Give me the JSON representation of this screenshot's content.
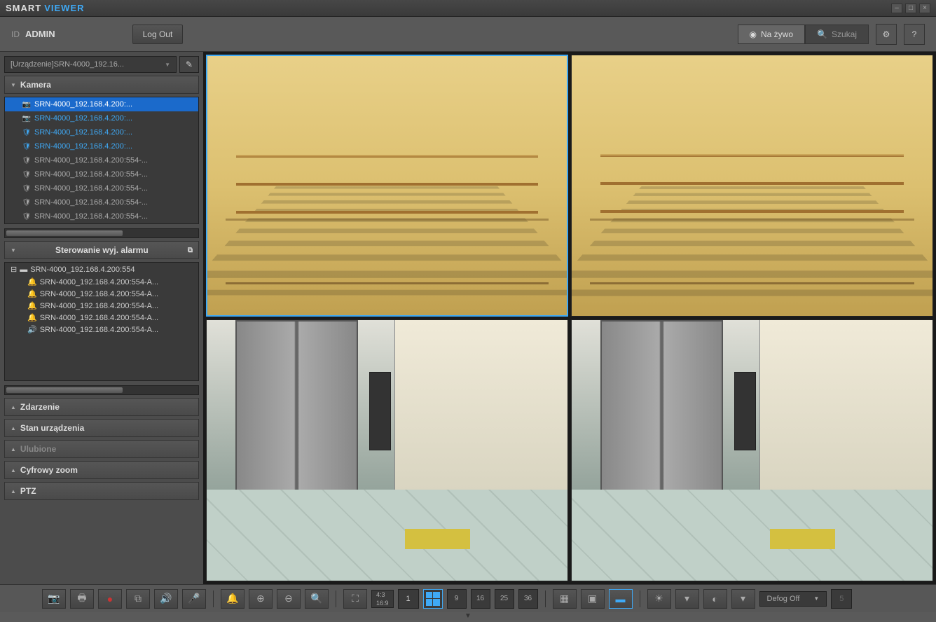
{
  "app": {
    "title1": "SMART",
    "title2": "VIEWER"
  },
  "user": {
    "idlabel": "ID",
    "name": "ADMIN",
    "logout": "Log Out"
  },
  "modes": {
    "live": "Na żywo",
    "search": "Szukaj"
  },
  "device_selector": "[Urządzenie]SRN-4000_192.16...",
  "sections": {
    "camera": "Kamera",
    "alarm": "Sterowanie wyj. alarmu",
    "event": "Zdarzenie",
    "devstatus": "Stan urządzenia",
    "favorites": "Ulubione",
    "zoom": "Cyfrowy zoom",
    "ptz": "PTZ"
  },
  "cameras": [
    {
      "label": "SRN-4000_192.168.4.200:...",
      "state": "selected"
    },
    {
      "label": "SRN-4000_192.168.4.200:...",
      "state": "active"
    },
    {
      "label": "SRN-4000_192.168.4.200:...",
      "state": "active"
    },
    {
      "label": "SRN-4000_192.168.4.200:...",
      "state": "active"
    },
    {
      "label": "SRN-4000_192.168.4.200:554-...",
      "state": "normal"
    },
    {
      "label": "SRN-4000_192.168.4.200:554-...",
      "state": "normal"
    },
    {
      "label": "SRN-4000_192.168.4.200:554-...",
      "state": "normal"
    },
    {
      "label": "SRN-4000_192.168.4.200:554-...",
      "state": "normal"
    },
    {
      "label": "SRN-4000_192.168.4.200:554-...",
      "state": "normal"
    }
  ],
  "alarm": {
    "root": "SRN-4000_192.168.4.200:554",
    "children": [
      "SRN-4000_192.168.4.200:554-A...",
      "SRN-4000_192.168.4.200:554-A...",
      "SRN-4000_192.168.4.200:554-A...",
      "SRN-4000_192.168.4.200:554-A...",
      "SRN-4000_192.168.4.200:554-A..."
    ]
  },
  "aspect": {
    "r1": "4:3",
    "r2": "16:9"
  },
  "page": "1",
  "layouts": [
    "9",
    "16",
    "25",
    "36"
  ],
  "defog": "Defog Off",
  "defog_level": "5"
}
